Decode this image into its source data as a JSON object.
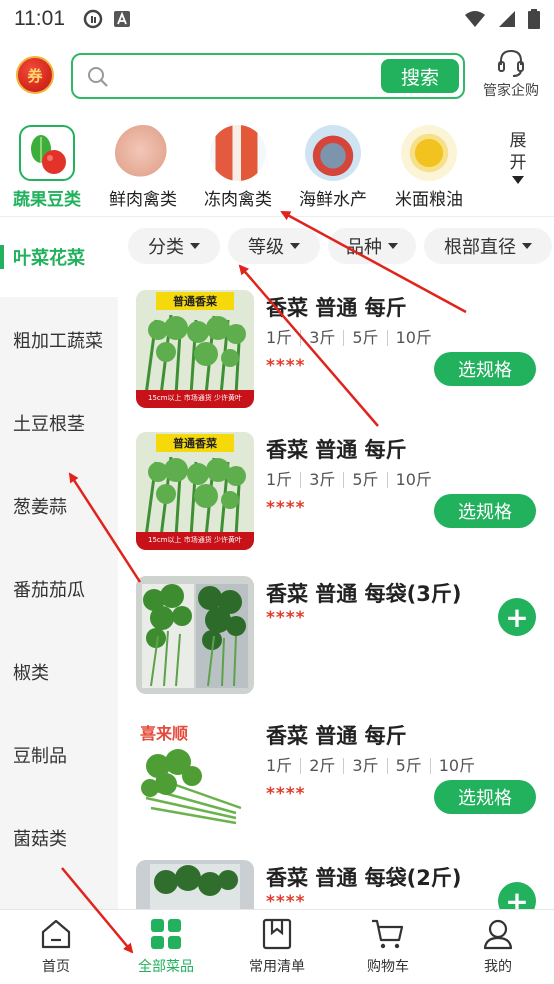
{
  "status": {
    "time": "11:01"
  },
  "header": {
    "coupon_label": "券",
    "search": {
      "placeholder": "",
      "button_label": "搜索"
    },
    "butler_label": "管家企购"
  },
  "categories": [
    {
      "label": "蔬果豆类",
      "active": true
    },
    {
      "label": "鲜肉禽类",
      "active": false
    },
    {
      "label": "冻肉禽类",
      "active": false
    },
    {
      "label": "海鲜水产",
      "active": false
    },
    {
      "label": "米面粮油",
      "active": false
    }
  ],
  "expand": {
    "line1": "展",
    "line2": "开"
  },
  "sidebar": {
    "items": [
      {
        "label": "叶菜花菜",
        "active": true
      },
      {
        "label": "粗加工蔬菜"
      },
      {
        "label": "土豆根茎"
      },
      {
        "label": "葱姜蒜"
      },
      {
        "label": "番茄茄瓜"
      },
      {
        "label": "椒类"
      },
      {
        "label": "豆制品"
      },
      {
        "label": "菌菇类"
      }
    ]
  },
  "filters": [
    "分类",
    "等级",
    "品种",
    "根部直径"
  ],
  "products": [
    {
      "title": "香菜 普通 每斤",
      "specs": [
        "1斤",
        "3斤",
        "5斤",
        "10斤"
      ],
      "price": "****",
      "action": "选规格",
      "image_banner": "普通香菜",
      "image_caption": "15cm以上 市场通货 少许黄叶"
    },
    {
      "title": "香菜 普通 每斤",
      "specs": [
        "1斤",
        "3斤",
        "5斤",
        "10斤"
      ],
      "price": "****",
      "action": "选规格",
      "image_banner": "普通香菜",
      "image_caption": "15cm以上 市场通货 少许黄叶"
    },
    {
      "title": "香菜 普通 每袋(3斤)",
      "specs": [],
      "price": "****",
      "action": "+"
    },
    {
      "title": "香菜 普通 每斤",
      "specs": [
        "1斤",
        "2斤",
        "3斤",
        "5斤",
        "10斤"
      ],
      "price": "****",
      "action": "选规格",
      "image_banner": "喜来顺"
    },
    {
      "title": "香菜 普通 每袋(2斤)",
      "specs": [],
      "price": "****",
      "action": "+"
    }
  ],
  "tabbar": [
    {
      "label": "首页",
      "icon": "home-icon"
    },
    {
      "label": "全部菜品",
      "icon": "grid-icon",
      "active": true
    },
    {
      "label": "常用清单",
      "icon": "bookmark-icon"
    },
    {
      "label": "购物车",
      "icon": "cart-icon"
    },
    {
      "label": "我的",
      "icon": "user-icon"
    }
  ],
  "colors": {
    "accent": "#22b15c",
    "price": "#e23b2a",
    "annotation_arrow": "#e0231b"
  }
}
